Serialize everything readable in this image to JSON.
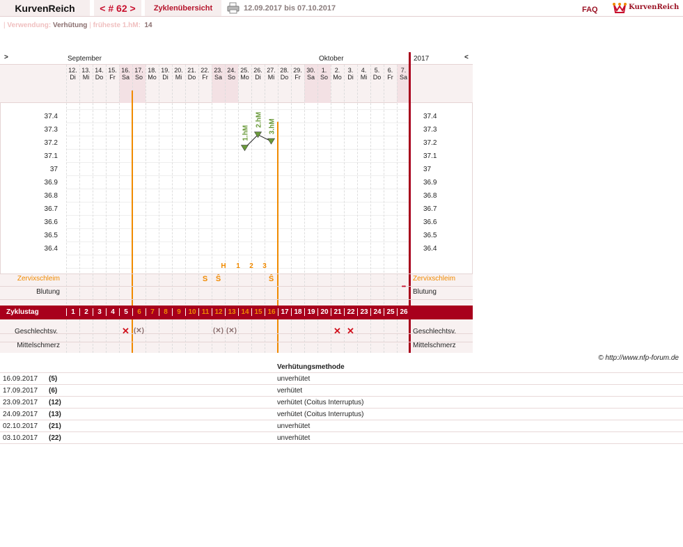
{
  "header": {
    "brand": "KurvenReich",
    "cycle_nav": "< # 62 >",
    "overview_link": "Zyklenübersicht",
    "date_range": "12.09.2017 bis 07.10.2017",
    "faq": "FAQ",
    "logo_text": "KurvenReich"
  },
  "subheader": {
    "usage_label": "Verwendung:",
    "usage_value": "Verhütung",
    "earliest_label": "früheste 1.hM:",
    "earliest_value": "14"
  },
  "chart": {
    "month_left": "September",
    "month_right": "Oktober",
    "year": "2017",
    "nav_prev": ">",
    "nav_next": "<",
    "days": [
      {
        "d": "12.",
        "w": "Di"
      },
      {
        "d": "13.",
        "w": "Mi"
      },
      {
        "d": "14.",
        "w": "Do"
      },
      {
        "d": "15.",
        "w": "Fr"
      },
      {
        "d": "16.",
        "w": "Sa"
      },
      {
        "d": "17.",
        "w": "So"
      },
      {
        "d": "18.",
        "w": "Mo"
      },
      {
        "d": "19.",
        "w": "Di"
      },
      {
        "d": "20.",
        "w": "Mi"
      },
      {
        "d": "21.",
        "w": "Do"
      },
      {
        "d": "22.",
        "w": "Fr"
      },
      {
        "d": "23.",
        "w": "Sa"
      },
      {
        "d": "24.",
        "w": "So"
      },
      {
        "d": "25.",
        "w": "Mo"
      },
      {
        "d": "26.",
        "w": "Di"
      },
      {
        "d": "27.",
        "w": "Mi"
      },
      {
        "d": "28.",
        "w": "Do"
      },
      {
        "d": "29.",
        "w": "Fr"
      },
      {
        "d": "30.",
        "w": "Sa"
      },
      {
        "d": "1.",
        "w": "So"
      },
      {
        "d": "2.",
        "w": "Mo"
      },
      {
        "d": "3.",
        "w": "Di"
      },
      {
        "d": "4.",
        "w": "Mi"
      },
      {
        "d": "5.",
        "w": "Do"
      },
      {
        "d": "6.",
        "w": "Fr"
      },
      {
        "d": "7.",
        "w": "Sa"
      }
    ],
    "weekend_indices": [
      4,
      5,
      11,
      12,
      18,
      19,
      25
    ],
    "temp_ticks": [
      "37.4",
      "37.3",
      "37.2",
      "37.1",
      "37",
      "36.9",
      "36.8",
      "36.7",
      "36.6",
      "36.5",
      "36.4"
    ],
    "temps": [
      {
        "day_index": 13,
        "value": 37.16,
        "label": "1.hM"
      },
      {
        "day_index": 14,
        "value": 37.26,
        "label": "2.hM"
      },
      {
        "day_index": 15,
        "value": 37.21,
        "label": "3.hM"
      }
    ],
    "hm_count_labels": [
      "H",
      "1",
      "2",
      "3"
    ],
    "rows": {
      "cervix": "Zervixschleim",
      "bleeding": "Blutung",
      "cycle_day": "Zyklustag",
      "intercourse": "Geschlechtsv.",
      "midpain": "Mittelschmerz"
    },
    "cervix_marks": [
      {
        "day_index": 10,
        "text": "S"
      },
      {
        "day_index": 11,
        "text": "Ŝ"
      },
      {
        "day_index": 15,
        "text": "Ŝ"
      }
    ],
    "bleeding_mark": "•••",
    "cycle_days": [
      "1",
      "2",
      "3",
      "4",
      "5",
      "6",
      "7",
      "8",
      "9",
      "10",
      "11",
      "12",
      "13",
      "14",
      "15",
      "16",
      "17",
      "18",
      "19",
      "20",
      "21",
      "22",
      "23",
      "24",
      "25",
      "26"
    ],
    "intercourse_marks": [
      {
        "day_index": 4,
        "text": "✕",
        "type": "unprotected"
      },
      {
        "day_index": 5,
        "text": "(✕)",
        "type": "protected"
      },
      {
        "day_index": 11,
        "text": "(✕)",
        "type": "protected"
      },
      {
        "day_index": 12,
        "text": "(✕)",
        "type": "protected"
      },
      {
        "day_index": 20,
        "text": "✕",
        "type": "unprotected"
      },
      {
        "day_index": 21,
        "text": "✕",
        "type": "unprotected"
      }
    ],
    "colors": {
      "accent_red": "#a8001c",
      "orange": "#f08a00",
      "green": "#6a9a3a",
      "weekend": "#f3e1e4",
      "panel": "#f8f1f1"
    }
  },
  "copyright": "© http://www.nfp-forum.de",
  "methods": {
    "header": "Verhütungsmethode",
    "rows": [
      {
        "date": "16.09.2017",
        "cd": "(5)",
        "method": "unverhütet"
      },
      {
        "date": "17.09.2017",
        "cd": "(6)",
        "method": "verhütet"
      },
      {
        "date": "23.09.2017",
        "cd": "(12)",
        "method": "verhütet (Coitus Interruptus)"
      },
      {
        "date": "24.09.2017",
        "cd": "(13)",
        "method": "verhütet (Coitus Interruptus)"
      },
      {
        "date": "02.10.2017",
        "cd": "(21)",
        "method": "unverhütet"
      },
      {
        "date": "03.10.2017",
        "cd": "(22)",
        "method": "unverhütet"
      }
    ]
  }
}
